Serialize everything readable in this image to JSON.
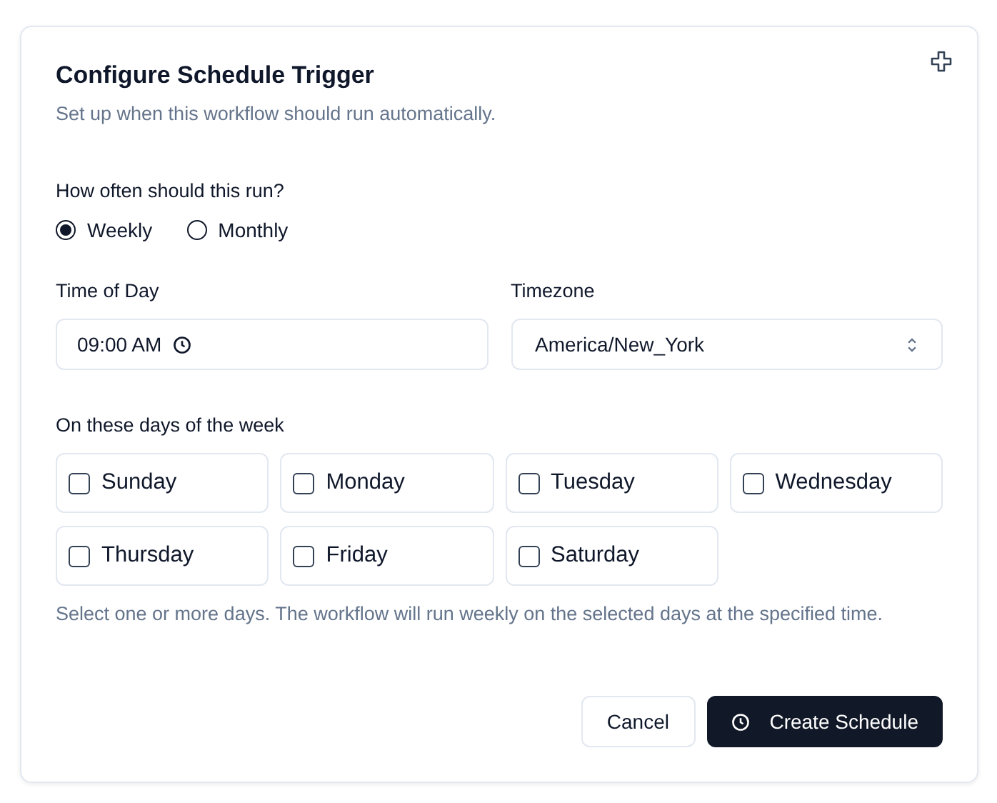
{
  "dialog": {
    "title": "Configure Schedule Trigger",
    "description": "Set up when this workflow should run automatically."
  },
  "frequency": {
    "label": "How often should this run?",
    "options": [
      {
        "label": "Weekly",
        "selected": true
      },
      {
        "label": "Monthly",
        "selected": false
      }
    ]
  },
  "time_of_day": {
    "label": "Time of Day",
    "value": "09:00 AM"
  },
  "timezone": {
    "label": "Timezone",
    "value": "America/New_York"
  },
  "days": {
    "label": "On these days of the week",
    "items": [
      {
        "label": "Sunday",
        "checked": false
      },
      {
        "label": "Monday",
        "checked": false
      },
      {
        "label": "Tuesday",
        "checked": false
      },
      {
        "label": "Wednesday",
        "checked": false
      },
      {
        "label": "Thursday",
        "checked": false
      },
      {
        "label": "Friday",
        "checked": false
      },
      {
        "label": "Saturday",
        "checked": false
      }
    ],
    "help": "Select one or more days. The workflow will run weekly on the selected days at the specified time."
  },
  "buttons": {
    "cancel": "Cancel",
    "create": "Create Schedule"
  }
}
